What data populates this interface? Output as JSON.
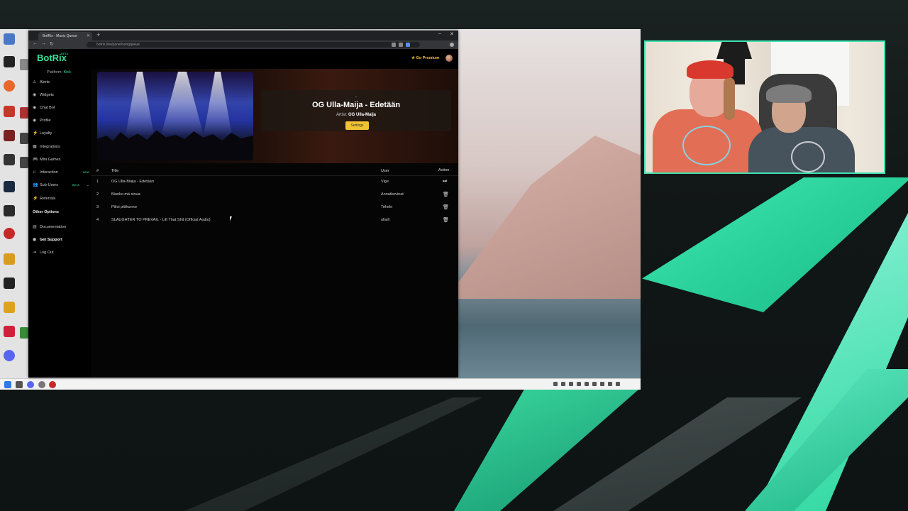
{
  "browser": {
    "tab_title": "BotRix - Music Queue",
    "url": "botrix.live/panel/songqueue"
  },
  "app": {
    "logo": "BotRix",
    "logo_tag": "BETA",
    "platform_label": "Platform:",
    "platform_value": "Kick",
    "premium_label": "Go Premium"
  },
  "sidebar": {
    "items": [
      {
        "icon": "⚠",
        "label": "Alerts"
      },
      {
        "icon": "◉",
        "label": "Widgets"
      },
      {
        "icon": "◉",
        "label": "Chat Bot"
      },
      {
        "icon": "◉",
        "label": "Profile"
      },
      {
        "icon": "⚡",
        "label": "Loyalty"
      },
      {
        "icon": "▦",
        "label": "Integrations"
      },
      {
        "icon": "🎮",
        "label": "Mini Games"
      },
      {
        "icon": "♫",
        "label": "Interaction",
        "tag": "NEW"
      },
      {
        "icon": "👥",
        "label": "Sub-Users",
        "tag": "BETA"
      },
      {
        "icon": "⚡",
        "label": "Referrals"
      }
    ],
    "other_heading": "Other Options",
    "other_items": [
      {
        "icon": "▤",
        "label": "Documentation"
      },
      {
        "icon": "◉",
        "label": "Get Support"
      },
      {
        "icon": "⇥",
        "label": "Log Out"
      }
    ]
  },
  "now_playing": {
    "title": "OG Ulla-Maija - Edetään",
    "artist_label": "Artist:",
    "artist": "OG Ulla-Maija",
    "settings_label": "Settings"
  },
  "queue": {
    "headers": {
      "num": "#",
      "title": "Title",
      "user": "User",
      "action": "Action"
    },
    "rows": [
      {
        "num": "1",
        "title": "OG Ulla-Maija - Edetään",
        "user": "Vige",
        "action": "⏭"
      },
      {
        "num": "2",
        "title": "Bianko mä sinua",
        "user": "Annatkovinat",
        "action": "🗑"
      },
      {
        "num": "3",
        "title": "Piiloi pitthunno",
        "user": "Tohelo",
        "action": "🗑"
      },
      {
        "num": "4",
        "title": "SLAUGHTER TO PREVAIL - Lift That Shit (Official Audio)",
        "user": "olisill",
        "action": "🗑"
      }
    ]
  },
  "colors": {
    "accent": "#37e39b",
    "premium": "#f1c232",
    "cam_border": "#3ee2b0"
  }
}
